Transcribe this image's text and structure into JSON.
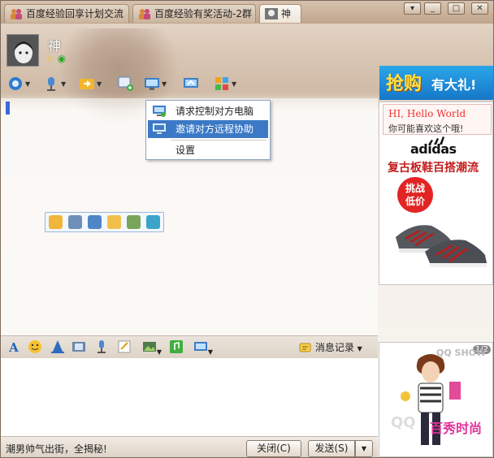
{
  "tabs": [
    {
      "label": "百度经验回享计划交流"
    },
    {
      "label": "百度经验有奖活动-2群"
    },
    {
      "label": "神"
    }
  ],
  "window_controls": {
    "menu": "▾",
    "minimize": "_",
    "maximize": "□",
    "close": "✕"
  },
  "contact": {
    "name": "神"
  },
  "ad_top": {
    "big": "抢购",
    "small": "有大礼!"
  },
  "menu": {
    "items": [
      {
        "label": "请求控制对方电脑"
      },
      {
        "label": "邀请对方远程协助"
      },
      {
        "label": "设置"
      }
    ]
  },
  "ad_panel": {
    "hi": "HI,",
    "hello": "Hello World",
    "question": "你可能喜欢这个哦!",
    "brand": "adidas",
    "slogan": "复古板鞋百搭潮流",
    "badge_line1": "挑战",
    "badge_line2": "低价"
  },
  "input_toolbar": {
    "history_label": "消息记录"
  },
  "qqshow": {
    "page": "1/2",
    "watermark": "QQ SHOW",
    "brand": "百秀时尚"
  },
  "bottom": {
    "promo": "潮男帅气出街，全揭秘!",
    "close_label": "关闭(C)",
    "send_label": "发送(S)"
  }
}
